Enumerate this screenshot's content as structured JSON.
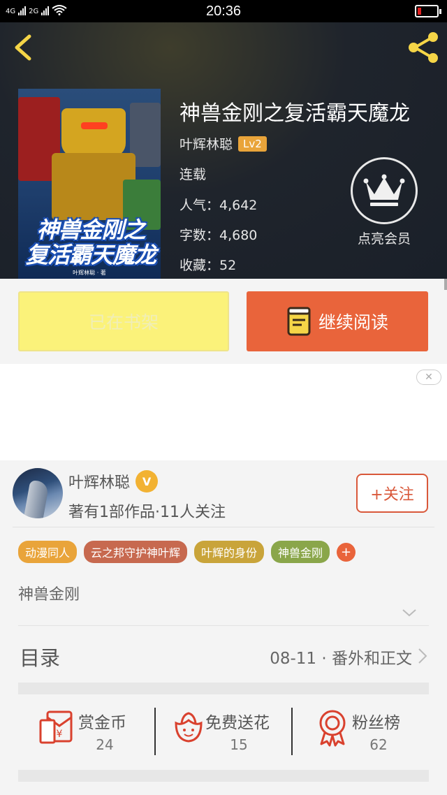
{
  "status_bar": {
    "left_label_1": "4G",
    "left_label_2": "2G",
    "time": "20:36",
    "battery_level_pct": 20
  },
  "book": {
    "title": "神兽金刚之复活霸天魔龙",
    "author": "叶辉林聪",
    "author_level": "Lv2",
    "status": "连载",
    "popularity": "人气：4,642",
    "word_count": "字数：4,680",
    "favorites": "收藏：52",
    "cover_title_line1": "神兽金刚之",
    "cover_title_line2": "复活霸天魔龙",
    "cover_author": "叶辉林聪 · 著"
  },
  "vip": {
    "label": "点亮会员",
    "icon": "crown-icon"
  },
  "actions": {
    "shelf_label": "已在书架",
    "read_label": "继续阅读",
    "read_icon": "book-icon"
  },
  "ad": {
    "close_icon": "close-icon"
  },
  "author_card": {
    "name": "叶辉林聪",
    "verified_badge": "V",
    "stats": "著有1部作品·11人关注",
    "follow_label": "+关注"
  },
  "tags": [
    {
      "label": "动漫同人",
      "color": "#e9a43a"
    },
    {
      "label": "云之邦守护神叶辉",
      "color": "#c7694f"
    },
    {
      "label": "叶辉的身份",
      "color": "#c9a43a"
    },
    {
      "label": "神兽金刚",
      "color": "#8aa64a"
    }
  ],
  "tag_add_label": "+",
  "description": "神兽金刚",
  "catalog": {
    "label": "目录",
    "latest": "08-11 · 番外和正文"
  },
  "stats": [
    {
      "label": "赏金币",
      "value": "24",
      "icon": "reward-envelope-icon"
    },
    {
      "label": "免费送花",
      "value": "15",
      "icon": "flower-icon"
    },
    {
      "label": "粉丝榜",
      "value": "62",
      "icon": "medal-icon"
    }
  ],
  "colors": {
    "accent": "#e9643b",
    "shelf_button": "#fbf27a",
    "header_bg": "#1f242c",
    "level_badge": "#e9a43a"
  }
}
